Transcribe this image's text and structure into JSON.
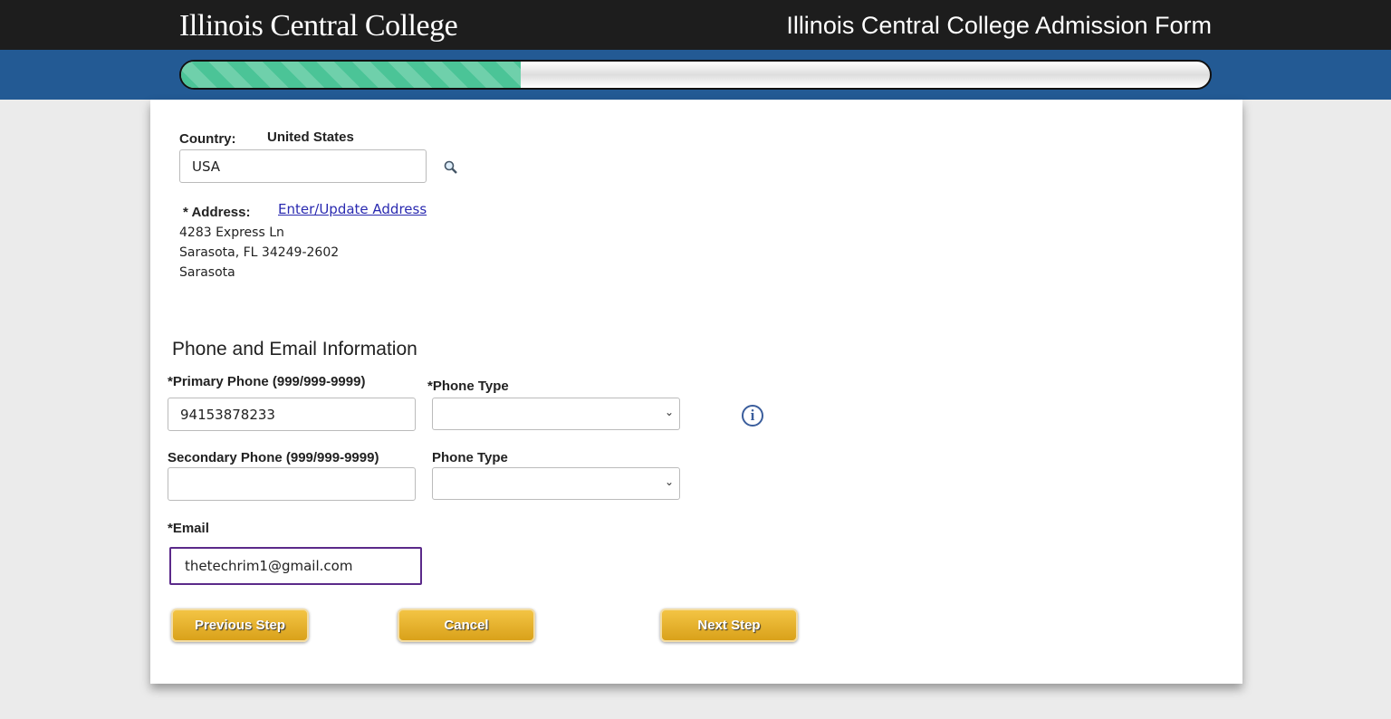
{
  "header": {
    "logo": "Illinois Central College",
    "title": "Illinois Central College Admission Form",
    "progress_percent": 33
  },
  "country": {
    "label": "Country:",
    "name": "United States",
    "value": "USA",
    "search_icon": "magnifier-icon"
  },
  "address": {
    "label": "* Address:",
    "link": "Enter/Update Address",
    "line1": "4283 Express Ln",
    "line2": "Sarasota, FL 34249-2602",
    "line3": "Sarasota"
  },
  "phone": {
    "section_title": "Phone and Email Information",
    "primary_label": "*Primary Phone (999/999-9999)",
    "primary_value": "94153878233",
    "primary_type_label": "*Phone Type",
    "secondary_label": "Secondary Phone (999/999-9999)",
    "secondary_value": "",
    "secondary_type_label": "Phone Type",
    "info_icon": "info-icon"
  },
  "email": {
    "label": "*Email",
    "value": "thetechrim1@gmail.com"
  },
  "buttons": {
    "previous": "Previous Step",
    "cancel": "Cancel",
    "next": "Next Step"
  }
}
